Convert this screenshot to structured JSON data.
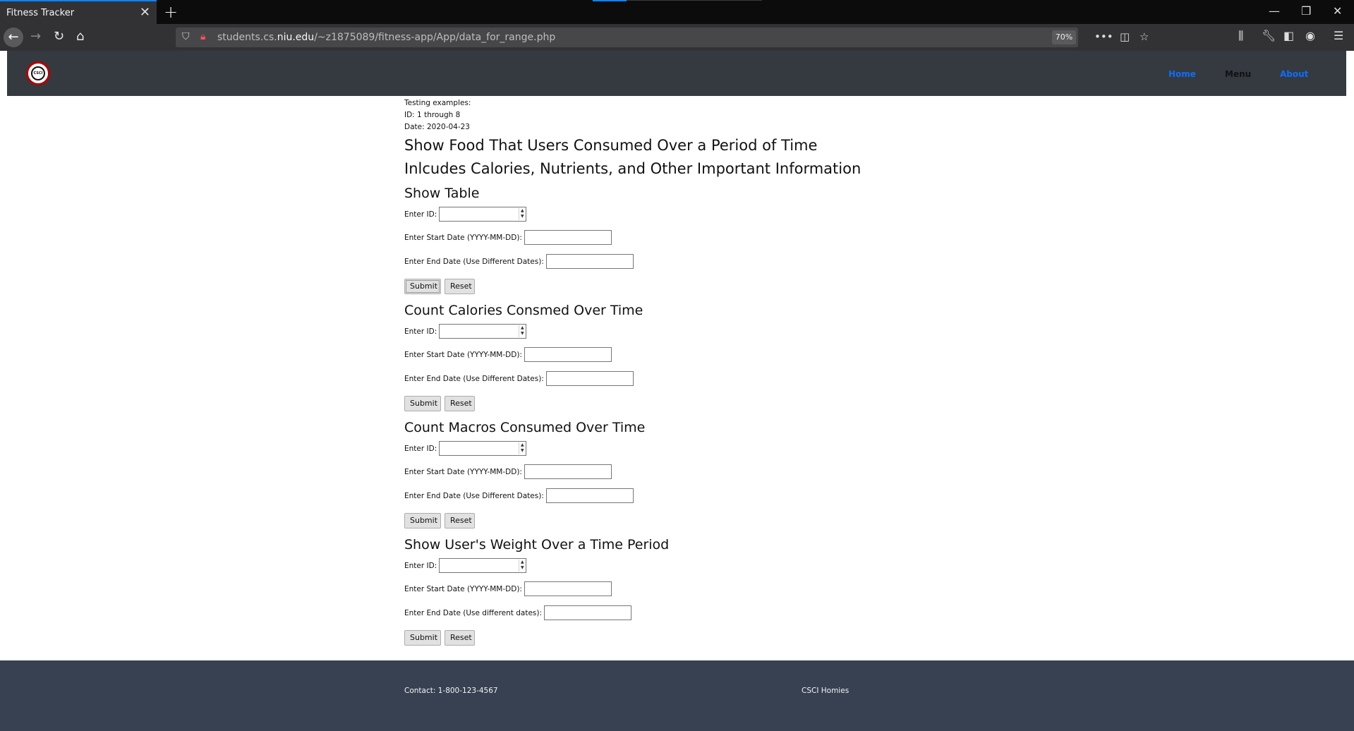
{
  "browser": {
    "tab_title": "Fitness Tracker",
    "url_prefix": "students.cs.",
    "url_host": "niu.edu",
    "url_path": "/~z1875089/fitness-app/App/data_for_range.php",
    "zoom": "70%"
  },
  "site": {
    "nav": {
      "home": "Home",
      "menu": "Menu",
      "about": "About"
    },
    "logo_text": "CSCI"
  },
  "testing": {
    "line1": "Testing examples:",
    "line2": "ID: 1 through 8",
    "line3": "Date: 2020-04-23"
  },
  "page_title": {
    "line1": "Show Food That Users Consumed Over a Period of Time",
    "line2": "Inlcudes Calories, Nutrients, and Other Important Information"
  },
  "sections": [
    {
      "title": "Show Table",
      "id_label": "Enter ID:",
      "start_label": "Enter Start Date (YYYY-MM-DD):",
      "end_label": "Enter End Date (Use Different Dates):",
      "submit": "Submit",
      "reset": "Reset"
    },
    {
      "title": "Count Calories Consmed Over Time",
      "id_label": "Enter ID:",
      "start_label": "Enter Start Date (YYYY-MM-DD):",
      "end_label": "Enter End Date (Use Different Dates):",
      "submit": "Submit",
      "reset": "Reset"
    },
    {
      "title": "Count Macros Consumed Over Time",
      "id_label": "Enter ID:",
      "start_label": "Enter Start Date (YYYY-MM-DD):",
      "end_label": "Enter End Date (Use Different Dates):",
      "submit": "Submit",
      "reset": "Reset"
    },
    {
      "title": "Show User's Weight Over a Time Period",
      "id_label": "Enter ID:",
      "start_label": "Enter Start Date (YYYY-MM-DD):",
      "end_label": "Enter End Date (Use different dates):",
      "submit": "Submit",
      "reset": "Reset"
    }
  ],
  "footer": {
    "contact": "Contact: 1-800-123-4567",
    "brand": "CSCI Homies"
  },
  "colors": {
    "header_bg": "#343a40",
    "footer_bg": "#374151",
    "nav_link": "#0d6efd",
    "logo_ring": "#b30000"
  }
}
